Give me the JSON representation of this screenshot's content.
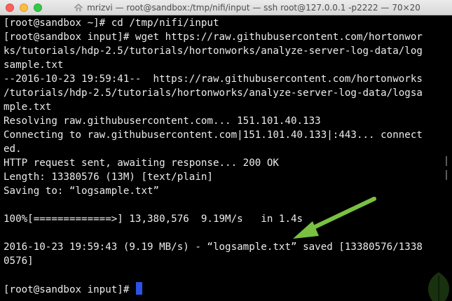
{
  "window": {
    "title": "mrizvi — root@sandbox:/tmp/nifi/input — ssh root@127.0.0.1 -p2222 — 70×20"
  },
  "terminal": {
    "lines": [
      "[root@sandbox ~]# cd /tmp/nifi/input",
      "[root@sandbox input]# wget https://raw.githubusercontent.com/hortonwor",
      "ks/tutorials/hdp-2.5/tutorials/hortonworks/analyze-server-log-data/log",
      "sample.txt",
      "--2016-10-23 19:59:41--  https://raw.githubusercontent.com/hortonworks",
      "/tutorials/hdp-2.5/tutorials/hortonworks/analyze-server-log-data/logsa",
      "mple.txt",
      "Resolving raw.githubusercontent.com... 151.101.40.133",
      "Connecting to raw.githubusercontent.com|151.101.40.133|:443... connect",
      "ed.",
      "HTTP request sent, awaiting response... 200 OK",
      "Length: 13380576 (13M) [text/plain]",
      "Saving to: “logsample.txt”",
      "",
      "100%[=============>] 13,380,576  9.19M/s   in 1.4s",
      "",
      "2016-10-23 19:59:43 (9.19 MB/s) - “logsample.txt” saved [13380576/1338",
      "0576]",
      "",
      "[root@sandbox input]# "
    ]
  },
  "colors": {
    "background": "#000000",
    "text": "#ececec",
    "cursor": "#2b53e8",
    "annotation_arrow": "#7ac142"
  },
  "icons": {
    "title_icon": "home-icon",
    "annotation": "arrow-icon"
  }
}
